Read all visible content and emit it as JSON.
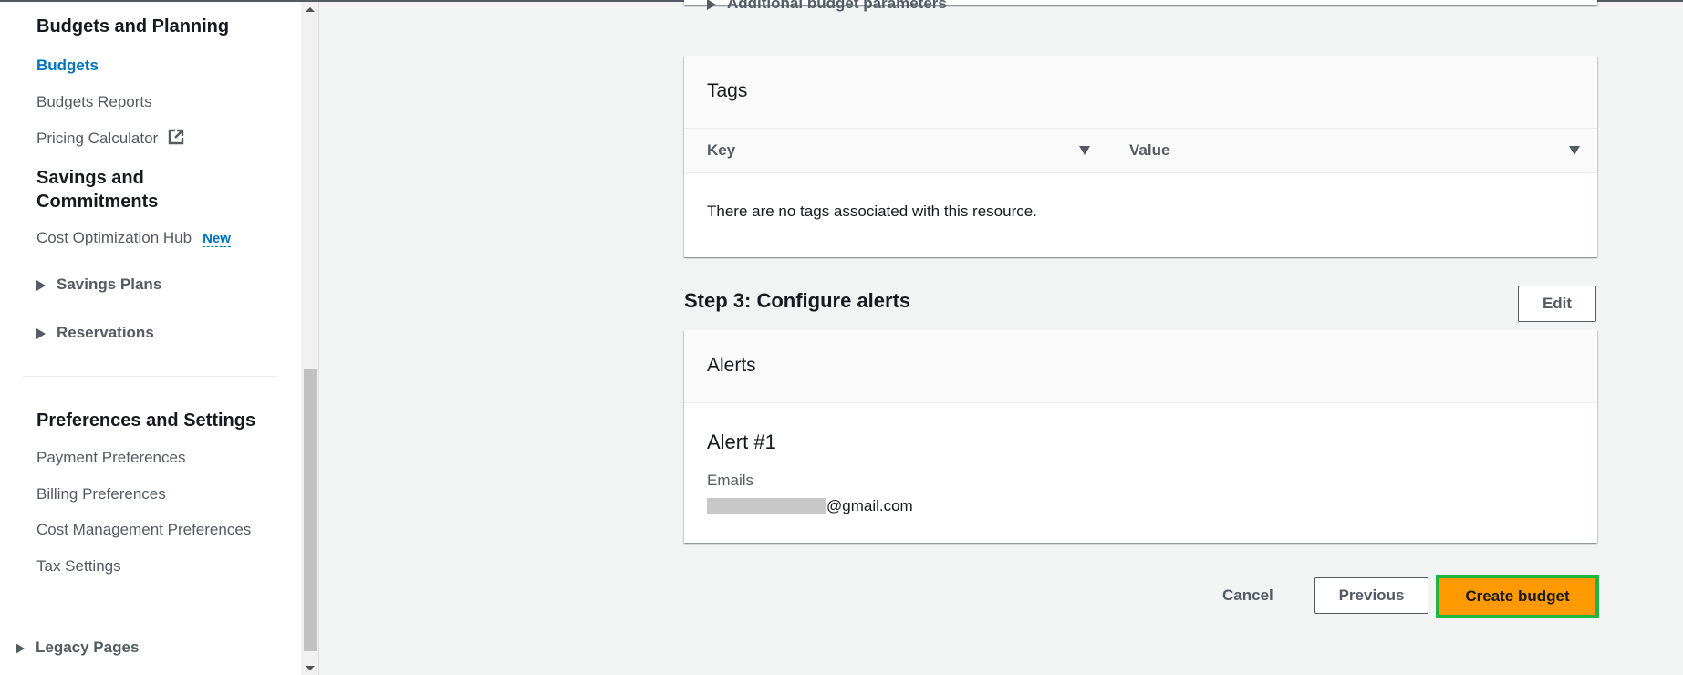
{
  "sidebar": {
    "budgets_planning": "Budgets and Planning",
    "budgets": "Budgets",
    "budgets_reports": "Budgets Reports",
    "pricing_calculator": "Pricing Calculator",
    "savings_commitments_1": "Savings and",
    "savings_commitments_2": "Commitments",
    "cost_optimization_hub": "Cost Optimization Hub",
    "new_badge": "New",
    "savings_plans": "Savings Plans",
    "reservations": "Reservations",
    "preferences_settings": "Preferences and Settings",
    "payment_preferences": "Payment Preferences",
    "billing_preferences": "Billing Preferences",
    "cost_management_preferences": "Cost Management Preferences",
    "tax_settings": "Tax Settings",
    "legacy_pages": "Legacy Pages"
  },
  "main": {
    "additional_params": "Additional budget parameters",
    "tags": {
      "title": "Tags",
      "columns": [
        "Key",
        "Value"
      ],
      "empty": "There are no tags associated with this resource."
    },
    "step3": {
      "title": "Step 3: Configure alerts",
      "edit": "Edit"
    },
    "alerts": {
      "title": "Alerts",
      "alert_title": "Alert #1",
      "emails_label": "Emails",
      "email_suffix": "@gmail.com"
    },
    "footer": {
      "cancel": "Cancel",
      "previous": "Previous",
      "create": "Create budget"
    }
  },
  "colors": {
    "accent": "#0073bb",
    "primary_button": "#ff9900",
    "highlight": "#1eb543"
  }
}
